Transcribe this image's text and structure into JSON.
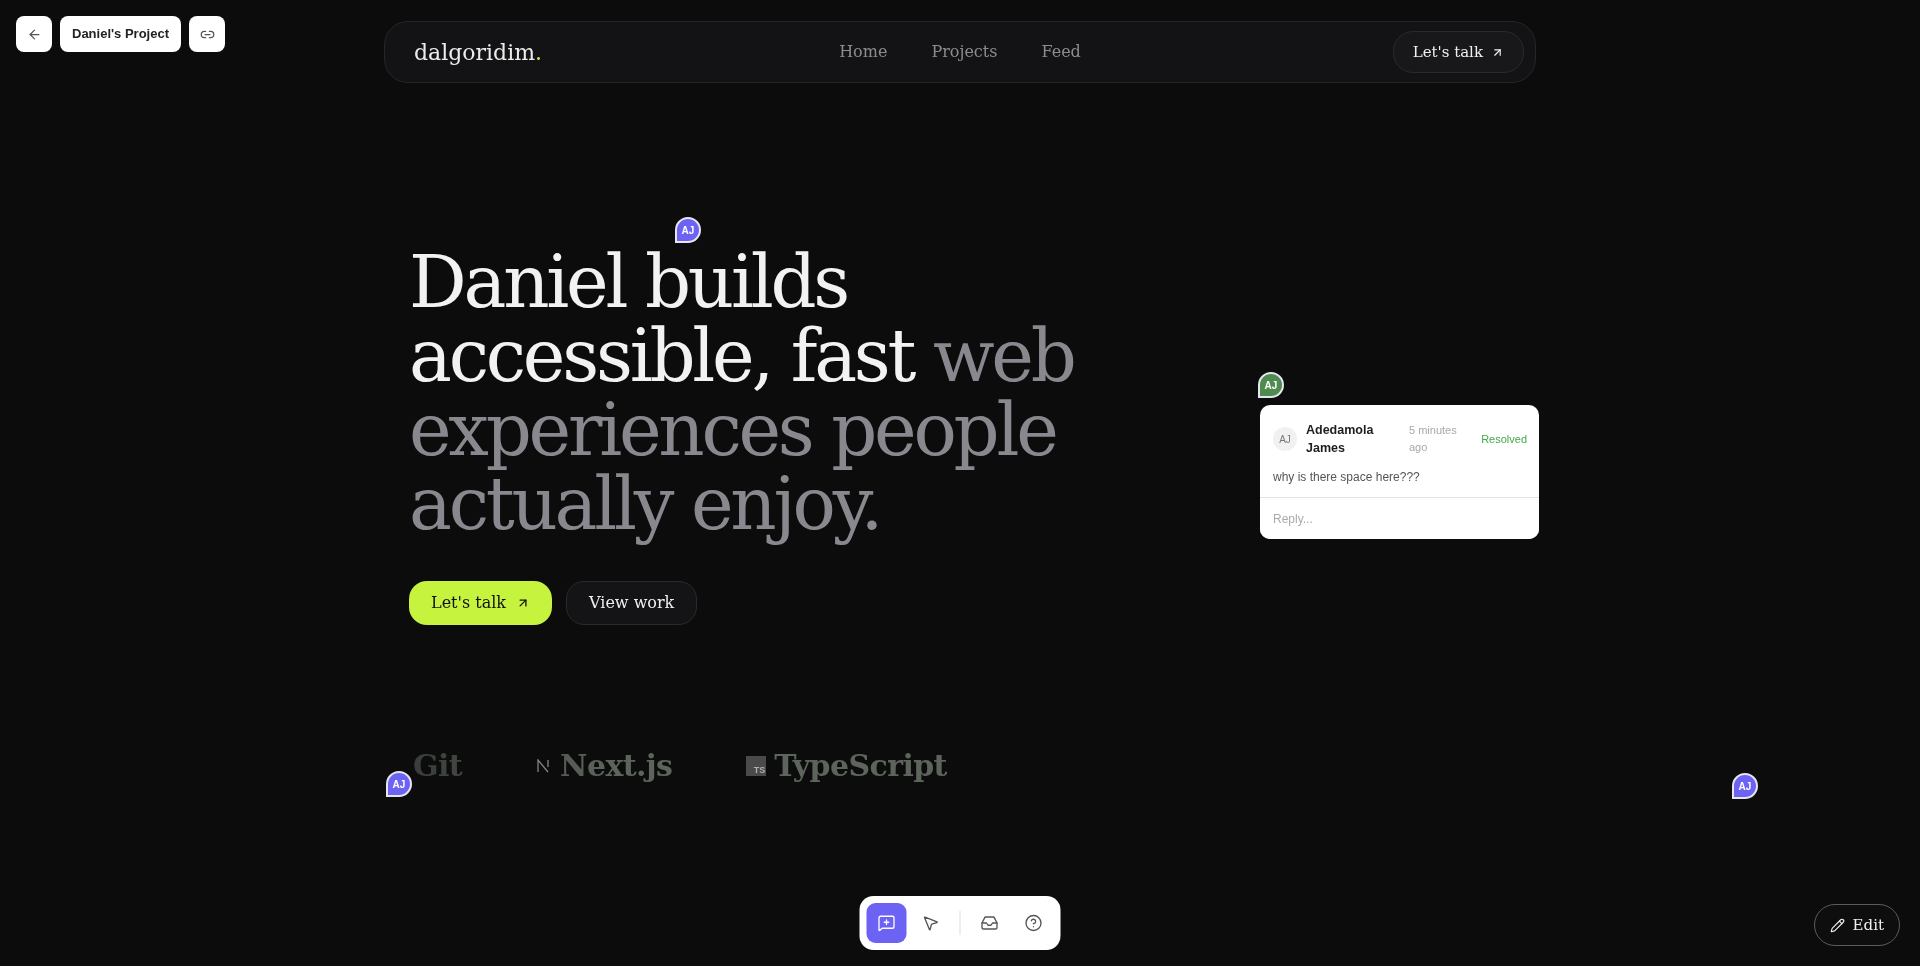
{
  "top_bar": {
    "project_name": "Daniel's Project"
  },
  "site_nav": {
    "logo": "dalgoridim",
    "logo_dot": ".",
    "links": [
      "Home",
      "Projects",
      "Feed"
    ],
    "cta": "Let's talk"
  },
  "hero": {
    "heading_lead": "Daniel builds accessible, fast",
    "heading_muted": "web experiences people actually enjoy.",
    "buttons": [
      {
        "kind": "primary",
        "label": "Let's talk"
      },
      {
        "kind": "secondary",
        "label": "View work"
      }
    ]
  },
  "tech_logos": [
    {
      "kind": "text",
      "name": "Git"
    },
    {
      "kind": "mark",
      "name": "Next.js"
    },
    {
      "kind": "badge",
      "badge": "TS",
      "name": "TypeScript"
    }
  ],
  "pins": [
    {
      "initials": "AJ",
      "color": "#6c63f5"
    },
    {
      "initials": "AJ",
      "color": "#4f8a4f"
    },
    {
      "initials": "AJ",
      "color": "#6c63f5"
    },
    {
      "initials": "AJ",
      "color": "#6c63f5"
    }
  ],
  "comment": {
    "avatar": "AJ",
    "author": "Adedamola James",
    "time": "5 minutes ago",
    "status": "Resolved",
    "text": "why is there space here???",
    "reply_placeholder": "Reply..."
  },
  "comment_toolbar": {
    "tools": [
      {
        "selected": true
      },
      {
        "selected": false
      },
      {
        "selected": false
      },
      {
        "selected": false
      }
    ]
  },
  "edit_button": {
    "label": "Edit"
  }
}
